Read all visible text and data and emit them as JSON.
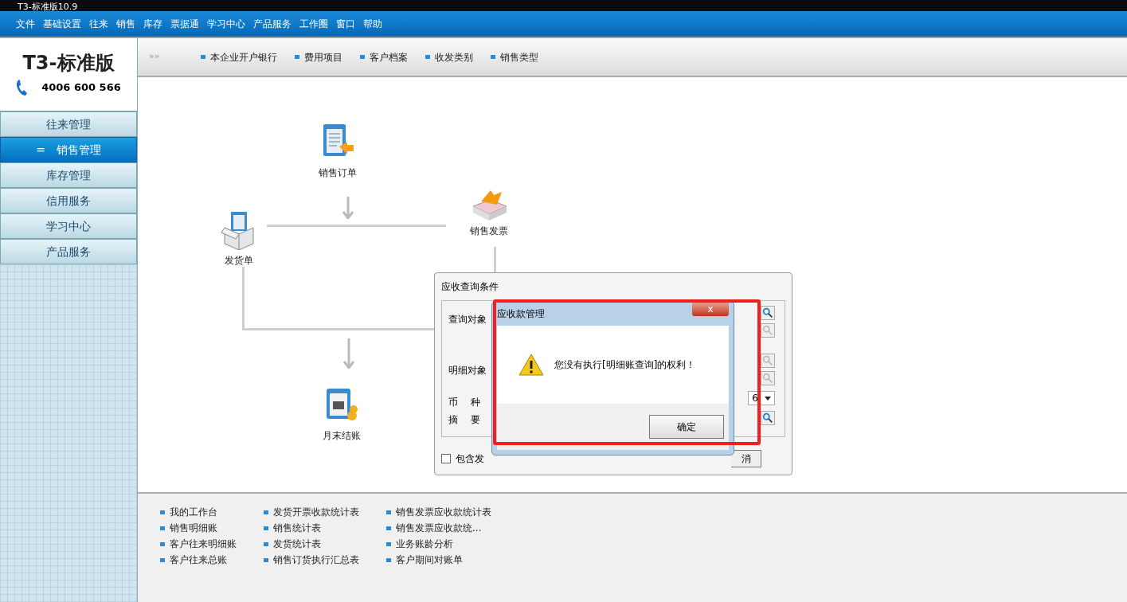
{
  "window": {
    "title": "T3-标准版10.9"
  },
  "menu": [
    "文件",
    "基础设置",
    "往来",
    "销售",
    "库存",
    "票据通",
    "学习中心",
    "产品服务",
    "工作圈",
    "窗口",
    "帮助"
  ],
  "logo": {
    "text": "T3-标准版",
    "phone": "4006 600 566"
  },
  "sidebar": {
    "items": [
      {
        "label": "往来管理",
        "selected": false
      },
      {
        "label": "销售管理",
        "selected": true
      },
      {
        "label": "库存管理",
        "selected": false
      },
      {
        "label": "信用服务",
        "selected": false
      },
      {
        "label": "学习中心",
        "selected": false
      },
      {
        "label": "产品服务",
        "selected": false
      }
    ],
    "expanded_marker": "="
  },
  "toolbar": {
    "chevron": "»»",
    "links": [
      "本企业开户银行",
      "费用项目",
      "客户档案",
      "收发类别",
      "销售类型"
    ]
  },
  "flow": {
    "nodes": [
      {
        "kind": "order",
        "label": "销售订单"
      },
      {
        "kind": "invoice",
        "label": "销售发票"
      },
      {
        "kind": "delivery",
        "label": "发货单"
      },
      {
        "kind": "closing",
        "label": "月末结账"
      }
    ]
  },
  "query_dialog": {
    "title": "应收查询条件",
    "labels": [
      "查询对象",
      "明细对象",
      "币",
      "种",
      "摘",
      "要"
    ],
    "currency_value": "6",
    "checkbox": {
      "label": "包含发",
      "checked": false
    },
    "button": "消"
  },
  "message_box": {
    "title": "应收款管理",
    "close": "x",
    "message": "您没有执行[明细账查询]的权利！",
    "button": "确定"
  },
  "bottom_links": [
    [
      "我的工作台",
      "销售明细账",
      "客户往来明细账",
      "客户往来总账"
    ],
    [
      "发货开票收款统计表",
      "销售统计表",
      "发货统计表",
      "销售订货执行汇总表"
    ],
    [
      "销售发票应收款统计表",
      "销售发票应收款统...",
      "业务账龄分析",
      "客户期间对账单"
    ]
  ]
}
